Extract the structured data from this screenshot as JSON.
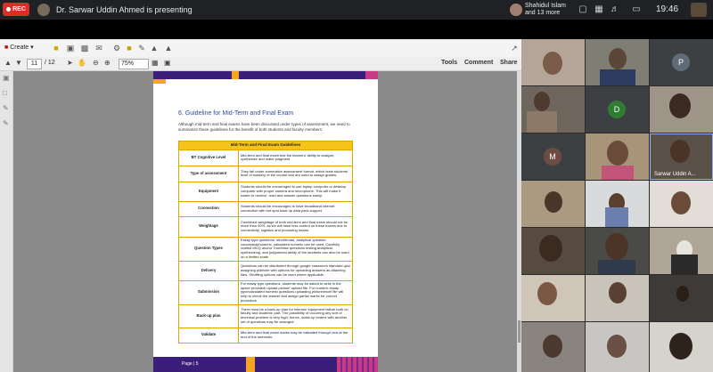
{
  "meet": {
    "rec_label": "REC",
    "presenting_text": "Dr. Sarwar Uddin Ahmed is presenting",
    "people_name": "Shahidul Islam",
    "people_more": "and 13 more",
    "clock": "19:46"
  },
  "reader": {
    "create_label": "Create",
    "page_current": "11",
    "page_total": "/ 12",
    "zoom": "75%",
    "tools_label": "Tools",
    "comment_label": "Comment",
    "share_label": "Share"
  },
  "doc": {
    "section_title": "6.  Guideline for Mid-Term and Final Exam",
    "intro": "Although mid-term and final exams have been discussed under types of assessment, we need to summarize these guidelines for the benefit of both students and faculty members:",
    "table_title": "Mid-Term and Final Exam Guidelines",
    "rows": [
      {
        "key": "BT Cognitive Level",
        "value": "Mid-term and final exam test the learners' ability to analyze, synthesize and make judgment."
      },
      {
        "key": "Type of assessment",
        "value": "They fall under summative assessment format, which tests students' level of mastery of the course and are used to assign grades."
      },
      {
        "key": "Equipment",
        "value": "Students should be encouraged to use laptop computer or desktop computer with proper camera and microphone. This will make it easier to receive, read and answer questions easily."
      },
      {
        "key": "Connection",
        "value": "Students should be encouraged to have broadband internet connection with hot spot back up data pack support."
      },
      {
        "key": "Weightage",
        "value": "Combined weightage of both mid-term and final exam should not be more than 50%, as we will have less control on these exams due to connectivity, logistics and proctoring issues."
      },
      {
        "key": "Question Types",
        "value": "Essay type questions: short/broad, analytical question: conceptual/numeric; calculated numeric can be used. Carefully crafted MCQ and/or True/false questions testing analytical, synthesizing, and judgmental ability of the students can also be used on a limited scale."
      },
      {
        "key": "Delivery",
        "value": "Questions can be distributed through google classroom standard quiz assigning platform with options for uploading answers as attaching files. Shuffling options can be used where applicable."
      },
      {
        "key": "Submission",
        "value": "For essay type questions, students may be asked to write in the space provided/ upload picture/ upload file. For numeric essay type/calculated numeric questions uploading picture/excel file will help to check the answer and assign partial marks for correct procedure."
      },
      {
        "key": "Back-up plan",
        "value": "There must be a back-up plan for internet/ equipment failure both on faculty and students' part. The possibility of occurring any sort of technical problem is very high; hence, make-up exams with another set of questions may be arranged."
      },
      {
        "key": "Validate",
        "value": "Mid-term and final exam marks may be validated through viva at the end of the semester."
      }
    ],
    "footer": "Page | 5"
  },
  "participants": {
    "p_initial": "P",
    "d_initial": "D",
    "m_initial": "M",
    "presenter_tile_name": "Sarwar Uddin A..."
  },
  "colors": {
    "rec": "#d93025",
    "doc_purple": "#3b1e7a",
    "doc_orange": "#f5a524",
    "doc_pink": "#c93a86",
    "table_header": "#f5c31a",
    "section_title": "#2f4a9a"
  }
}
